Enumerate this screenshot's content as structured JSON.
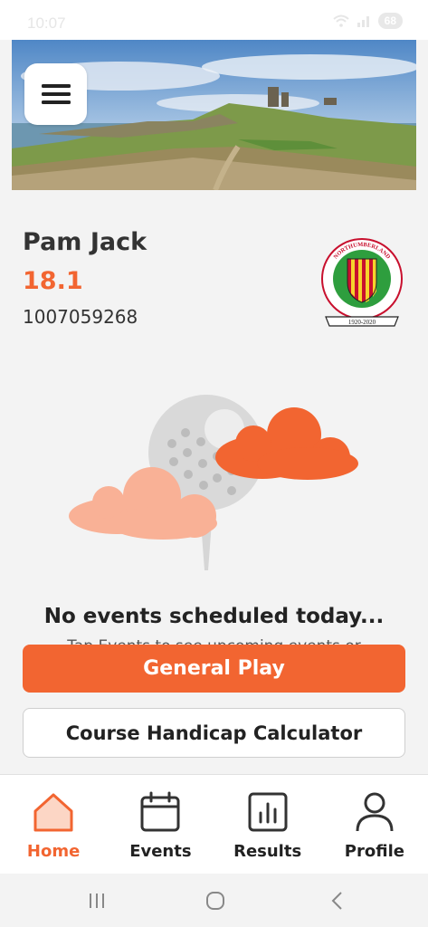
{
  "status_bar": {
    "time": "10:07",
    "battery": "68"
  },
  "profile": {
    "name": "Pam Jack",
    "handicap": "18.1",
    "member_id": "1007059268",
    "club_logo_text": "NORTHUMBERLAND LADIES COUNTY GOLF",
    "club_logo_years": "1920-2020"
  },
  "empty_state": {
    "title": "No events scheduled today...",
    "subtitle": "Tap Events to see upcoming events or"
  },
  "actions": {
    "primary_label": "General Play",
    "secondary_label": "Course Handicap Calculator"
  },
  "bottom_nav": {
    "items": [
      {
        "label": "Home",
        "icon": "home-icon",
        "active": true
      },
      {
        "label": "Events",
        "icon": "calendar-icon",
        "active": false
      },
      {
        "label": "Results",
        "icon": "chart-icon",
        "active": false
      },
      {
        "label": "Profile",
        "icon": "person-icon",
        "active": false
      }
    ]
  },
  "colors": {
    "accent": "#f26531",
    "cloud_light": "#f9b196",
    "text_dark": "#333333"
  }
}
